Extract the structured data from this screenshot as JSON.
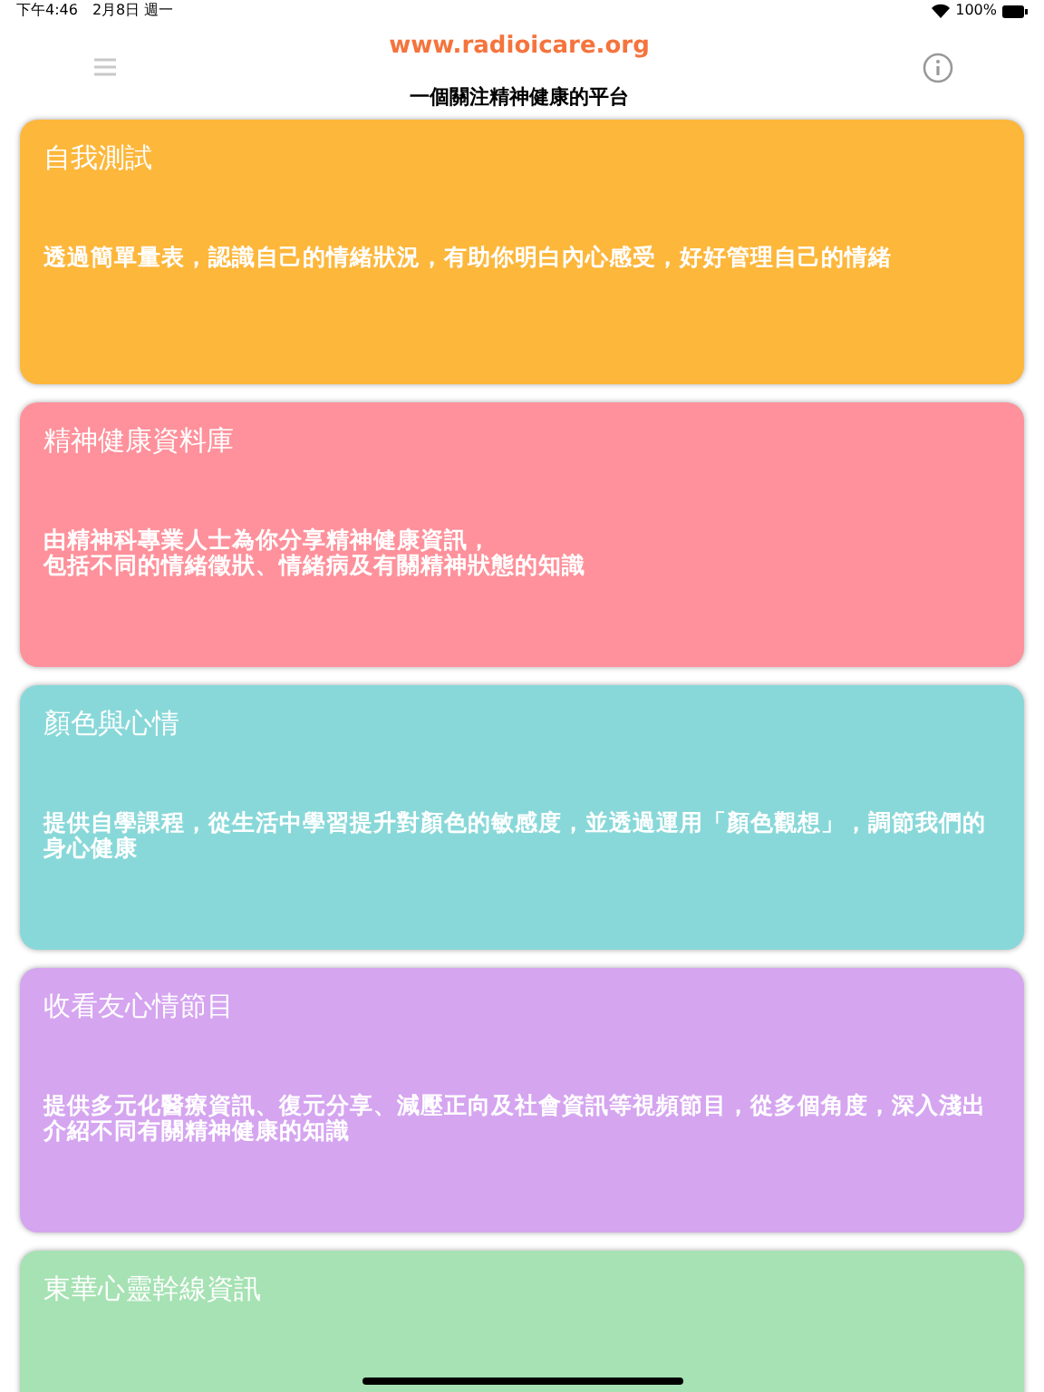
{
  "status_bar": {
    "time": "下午4:46",
    "date": "2月8日 週一",
    "battery": "100%"
  },
  "header": {
    "site": "www.radioicare.org",
    "subtitle": "一個關注精神健康的平台"
  },
  "cards": [
    {
      "title": "自我測試",
      "description": [
        "透過簡單量表，認識自己的情緒狀況，有助你明白內心感受，好好管理自己的情緒"
      ],
      "color": "#fdb73b"
    },
    {
      "title": "精神健康資料庫",
      "description": [
        "由精神科專業人士為你分享精神健康資訊，",
        "包括不同的情緒徵狀、情緒病及有關精神狀態的知識"
      ],
      "color": "#fe919b"
    },
    {
      "title": "顏色與心情",
      "description": [
        "提供自學課程，從生活中學習提升對顏色的敏感度，並透過運用「顏色觀想」，調節我們的身心健康"
      ],
      "color": "#89d8d9"
    },
    {
      "title": "收看友心情節目",
      "description": [
        "提供多元化醫療資訊、復元分享、減壓正向及社會資訊等視頻節目，從多個角度，深入淺出介紹不同有關精神健康的知識"
      ],
      "color": "#d5a5f0"
    },
    {
      "title": "東華心靈幹線資訊",
      "color": "#a6e2b3"
    }
  ]
}
